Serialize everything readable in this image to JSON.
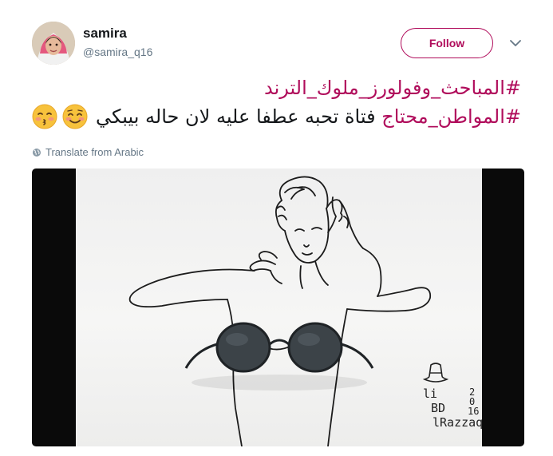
{
  "user": {
    "display_name": "samira",
    "handle": "@samira_q16"
  },
  "actions": {
    "follow_label": "Follow"
  },
  "tweet": {
    "line1_hashtag": "#المباحث_وفولورز_ملوك_الترند",
    "line2_hashtag": "#المواطن_محتاج",
    "line2_text": "فتاة تحبه عطفا عليه لان حاله بيبكي",
    "translate_label": "Translate from Arabic"
  },
  "media": {
    "signature": {
      "line1": "li",
      "line2": "BD",
      "line3": "lRazzaq",
      "year_top": "2",
      "year_mid": "0",
      "year_bottom": "16"
    }
  },
  "colors": {
    "accent": "#b00c5b",
    "secondary_text": "#657786"
  },
  "icons": {
    "more": "chevron-down-icon",
    "translate": "globe-icon",
    "emoji_1": "smiling-face-with-blush-emoji",
    "emoji_2": "kissing-face-closed-eyes-emoji"
  }
}
